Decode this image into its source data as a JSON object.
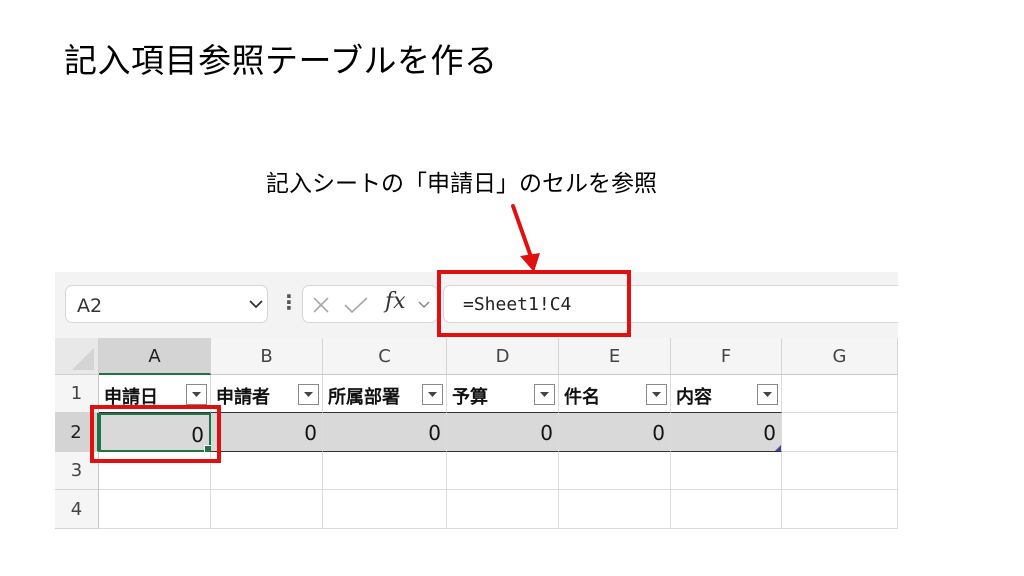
{
  "slide": {
    "title": "記入項目参照テーブルを作る",
    "annotation": "記入シートの「申請日」のセルを参照"
  },
  "excel": {
    "name_box": "A2",
    "fx_label": "fx",
    "formula": "=Sheet1!C4",
    "columns": [
      "A",
      "B",
      "C",
      "D",
      "E",
      "F",
      "G"
    ],
    "rows": [
      "1",
      "2",
      "3",
      "4"
    ],
    "selected_column": "A",
    "selected_row": "2",
    "table_headers": [
      "申請日",
      "申請者",
      "所属部署",
      "予算",
      "件名",
      "内容"
    ],
    "row2_values": [
      "0",
      "0",
      "0",
      "0",
      "0",
      "0"
    ]
  },
  "colors": {
    "highlight_red": "#e01010",
    "excel_green": "#217346",
    "value_fill": "#d9d9d9"
  }
}
